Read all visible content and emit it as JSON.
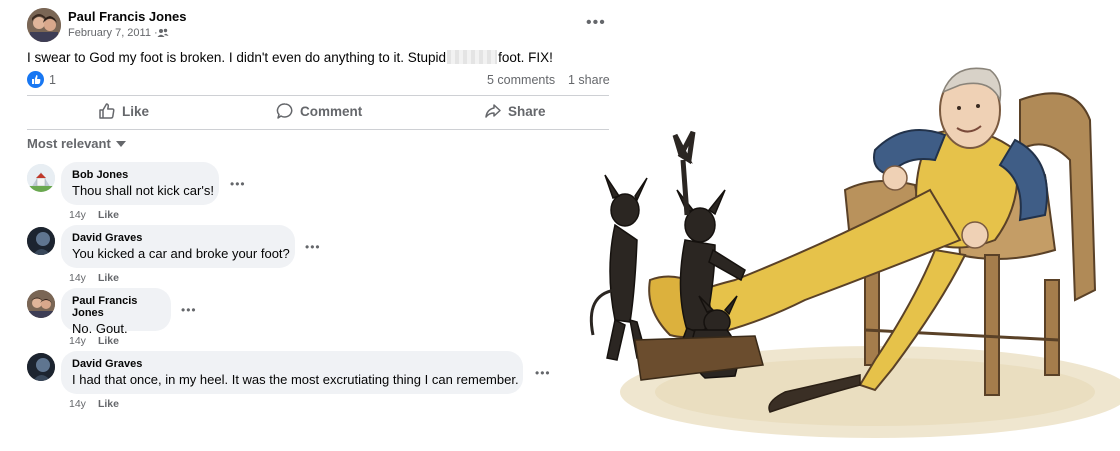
{
  "post": {
    "author": "Paul Francis Jones",
    "date": "February 7, 2011 ·",
    "text_before": "I swear to God my foot is broken.  I didn't even do anything to it.  Stupid",
    "text_after": "foot.  FIX!",
    "like_count": "1",
    "comments_count": "5 comments",
    "shares_count": "1 share",
    "actions": {
      "like": "Like",
      "comment": "Comment",
      "share": "Share"
    },
    "sort_label": "Most relevant",
    "more_icon": "more-horizontal-icon",
    "audience_icon": "friends-icon"
  },
  "comments": [
    {
      "name": "Bob Jones",
      "text": "Thou shall not kick car's!",
      "age": "14y",
      "like": "Like"
    },
    {
      "name": "David Graves",
      "text": "You kicked a car and broke your foot?",
      "age": "14y",
      "like": "Like"
    },
    {
      "name": "Paul Francis Jones",
      "text": "No. Gout.",
      "age": "14y",
      "like": "Like"
    },
    {
      "name": "David Graves",
      "text": "I had that once, in my heel. It was the most excrutiating thing I can remember.",
      "age": "14y",
      "like": "Like"
    }
  ],
  "colors": {
    "accent": "#1877f2",
    "muted": "#65676b",
    "bubble": "#f0f2f5",
    "divider": "#ced0d4"
  }
}
